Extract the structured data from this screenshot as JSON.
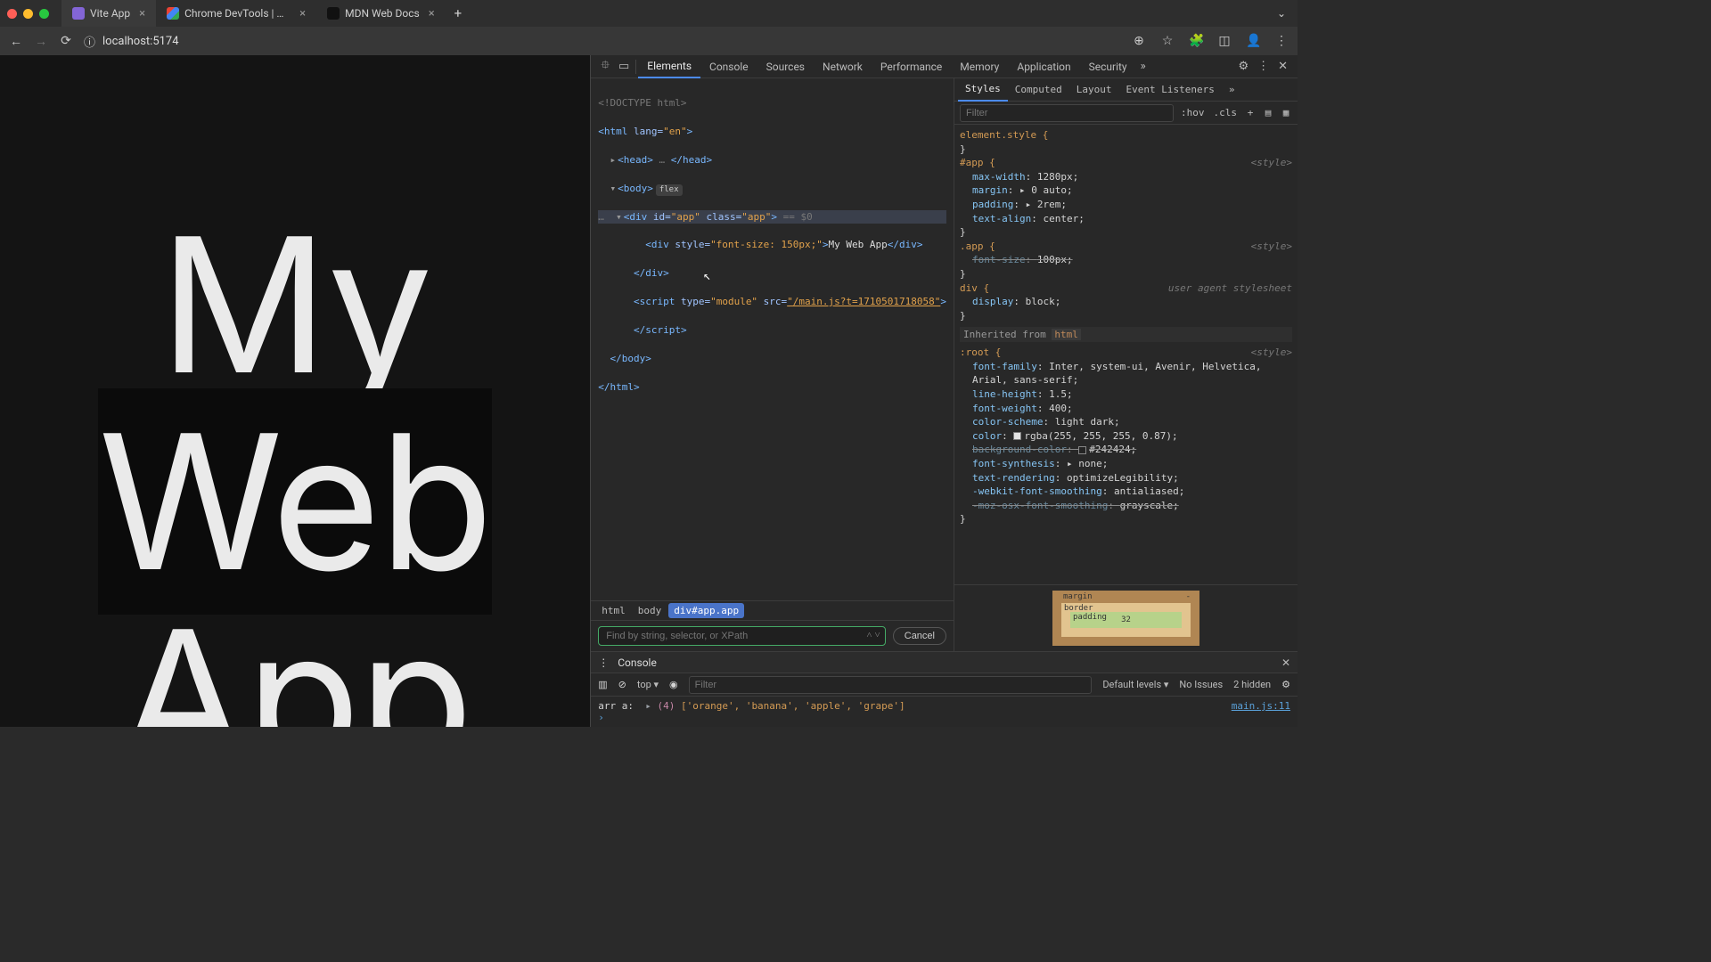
{
  "tabs": [
    {
      "title": "Vite App",
      "favicon": "#8365d6"
    },
    {
      "title": "Chrome DevTools | Chrome",
      "favicon": "#4285f4"
    },
    {
      "title": "MDN Web Docs",
      "favicon": "#111"
    }
  ],
  "url": "localhost:5174",
  "page_text": "My Web App",
  "devtools": {
    "tabs": [
      "Elements",
      "Console",
      "Sources",
      "Network",
      "Performance",
      "Memory",
      "Application",
      "Security"
    ],
    "active": "Elements"
  },
  "dom": {
    "l0": "<!DOCTYPE html>",
    "l1a": "<html",
    "l1b": " lang=",
    "l1c": "\"en\"",
    "l1d": ">",
    "l2a": "<head>",
    "l2b": " … ",
    "l2c": "</head>",
    "l3a": "<body>",
    "l3pill": "flex",
    "l4": "<div id=\"app\" class=\"app\">",
    "l4d": " == $0",
    "l5a": "<div",
    "l5b": " style=",
    "l5c": "\"font-size: 150px;\"",
    "l5d": ">",
    "l5e": "My Web App",
    "l5f": "</div>",
    "l6": "</div>",
    "l7a": "<script",
    "l7b": " type=",
    "l7c": "\"module\"",
    "l7d": " src=",
    "l7e": "\"/main.js?t=1710501718058\"",
    "l7f": ">",
    "l8": "</script>",
    "l9": "</body>",
    "l10": "</html>"
  },
  "crumbs": [
    "html",
    "body",
    "div#app.app"
  ],
  "find_placeholder": "Find by string, selector, or XPath",
  "cancel": "Cancel",
  "style_tabs": [
    "Styles",
    "Computed",
    "Layout",
    "Event Listeners"
  ],
  "filter_placeholder": "Filter",
  "fr_hov": ":hov",
  "fr_cls": ".cls",
  "rules": {
    "r0s": "element.style {",
    "r0e": "}",
    "r1s": "#app {",
    "src": "<style>",
    "r1p1n": "max-width",
    "r1p1v": "1280px;",
    "r1p2n": "margin",
    "r1p2v": "▸ 0 auto;",
    "r1p3n": "padding",
    "r1p3v": "▸ 2rem;",
    "r1p4n": "text-align",
    "r1p4v": "center;",
    "r1e": "}",
    "r2s": ".app {",
    "r2p1n": "font-size",
    "r2p1v": "100px;",
    "r2e": "}",
    "r3s": "div {",
    "r3src": "user agent stylesheet",
    "r3p1n": "display",
    "r3p1v": "block;",
    "r3e": "}",
    "inh_label": "Inherited from ",
    "inh_el": "html",
    "r4s": ":root {",
    "r4p1n": "font-family",
    "r4p1v": "Inter, system-ui, Avenir, Helvetica, Arial, sans-serif;",
    "r4p2n": "line-height",
    "r4p2v": "1.5;",
    "r4p3n": "font-weight",
    "r4p3v": "400;",
    "r4p4n": "color-scheme",
    "r4p4v": "light dark;",
    "r4p5n": "color",
    "r4p5v": "rgba(255, 255, 255, 0.87);",
    "r4p6n": "background-color",
    "r4p6v": "#242424;",
    "r4p7n": "font-synthesis",
    "r4p7v": "▸ none;",
    "r4p8n": "text-rendering",
    "r4p8v": "optimizeLegibility;",
    "r4p9n": "-webkit-font-smoothing",
    "r4p9v": "antialiased;",
    "r4p10n": "-moz-osx-font-smoothing",
    "r4p10v": "grayscale;",
    "r4e": "}"
  },
  "boxmodel": {
    "margin": "margin",
    "margin_v": "-",
    "border": "border",
    "padding": "padding",
    "padding_v": "32"
  },
  "console": {
    "title": "Console",
    "context": "top ▾",
    "filter": "Filter",
    "levels": "Default levels ▾",
    "issues": "No Issues",
    "hidden": "2 hidden",
    "log_label": "arr a:",
    "log_count": "(4)",
    "log_items": "['orange', 'banana', 'apple', 'grape']",
    "log_src": "main.js:11"
  }
}
